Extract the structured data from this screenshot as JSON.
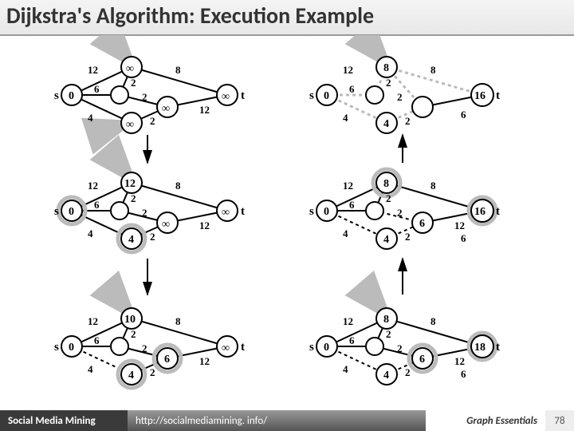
{
  "title": "Dijkstra's Algorithm: Execution Example",
  "footer": {
    "left": "Social Media Mining",
    "center": "http://socialmediamining. info/",
    "right": "Graph Essentials",
    "page": "78"
  },
  "labels": {
    "s": "s",
    "t": "t",
    "inf": "∞"
  },
  "weights": {
    "su": "12",
    "sd": "4",
    "sm": "6",
    "um": "2",
    "mc": "2",
    "dc": "2",
    "ut": "8",
    "ct": "12",
    "t6": "6"
  },
  "chart_data": {
    "type": "diagram",
    "note": "Six snapshots of Dijkstra shortest-path from s to t on a 5-node weighted graph",
    "edge_weights": {
      "s-u": 12,
      "s-m": 6,
      "s-d": 4,
      "u-m": 2,
      "m-c": 2,
      "d-c": 2,
      "u-t": 8,
      "c-t": 12,
      "d-t-alt": 6
    },
    "panels": [
      {
        "id": "A",
        "pos": "top-left",
        "dist": {
          "s": 0,
          "u": "∞",
          "m": "∞",
          "d": "∞",
          "c": "∞",
          "t": "∞"
        },
        "settled": [
          "s"
        ]
      },
      {
        "id": "B",
        "pos": "mid-left",
        "dist": {
          "s": 0,
          "u": 12,
          "m": null,
          "d": 4,
          "c": "∞",
          "t": "∞"
        },
        "settled": [
          "s",
          "d"
        ]
      },
      {
        "id": "C",
        "pos": "bot-left",
        "dist": {
          "s": 0,
          "u": 10,
          "m": null,
          "d": 4,
          "c": 6,
          "t": "∞"
        },
        "settled": [
          "s",
          "d",
          "c"
        ]
      },
      {
        "id": "D",
        "pos": "bot-right",
        "dist": {
          "s": 0,
          "u": 8,
          "m": null,
          "d": 4,
          "c": 6,
          "t": 18
        },
        "settled": [
          "s",
          "d",
          "c",
          "u"
        ]
      },
      {
        "id": "E",
        "pos": "mid-right",
        "dist": {
          "s": 0,
          "u": 8,
          "m": null,
          "d": 4,
          "c": 6,
          "t": 16
        },
        "settled": [
          "s",
          "d",
          "c",
          "u",
          "t"
        ]
      },
      {
        "id": "F",
        "pos": "top-right",
        "dist": {
          "s": 0,
          "u": 8,
          "m": 4,
          "d": null,
          "c": null,
          "t": 16
        },
        "settled": [
          "s",
          "d",
          "c",
          "u",
          "t"
        ],
        "final_path": [
          "s",
          "d",
          "c",
          "u",
          "t"
        ]
      }
    ]
  },
  "vals": {
    "A": {
      "s": "0"
    },
    "B": {
      "s": "0",
      "u": "12",
      "d": "4"
    },
    "C": {
      "s": "0",
      "u": "10",
      "d": "4",
      "c": "6"
    },
    "D": {
      "s": "0",
      "u": "8",
      "d": "4",
      "c": "6",
      "t": "18"
    },
    "E": {
      "s": "0",
      "u": "8",
      "d": "4",
      "c": "6",
      "t": "16"
    },
    "F": {
      "s": "0",
      "u": "8",
      "m": "4",
      "t": "16"
    }
  }
}
